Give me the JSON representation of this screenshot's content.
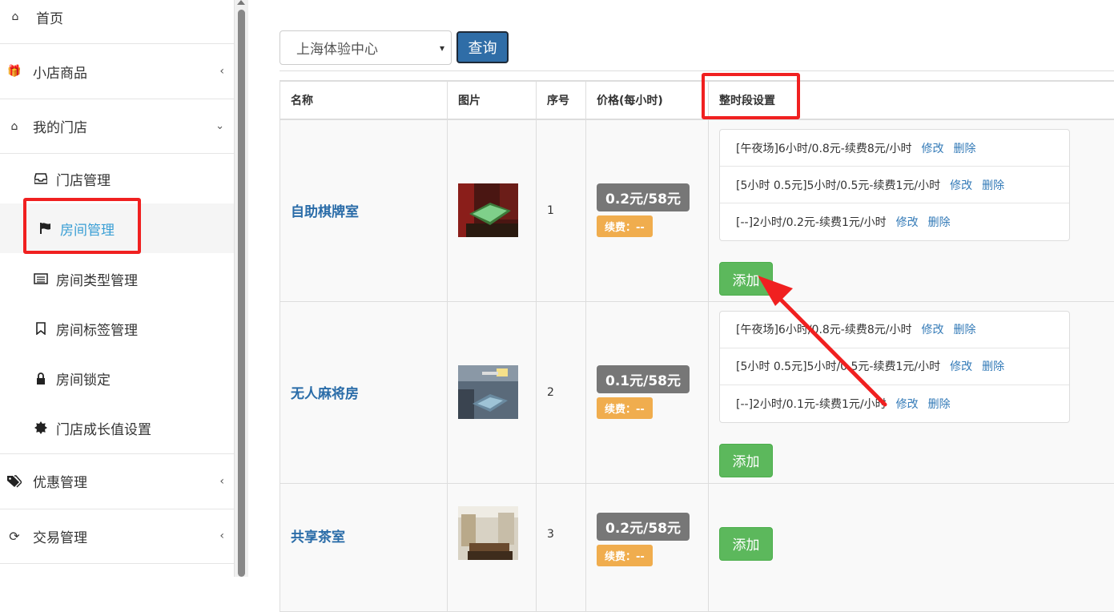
{
  "sidebar": {
    "home": "首页",
    "shop_goods": "小店商品",
    "my_store": "我的门店",
    "sub_items": [
      "门店管理",
      "房间管理",
      "房间类型管理",
      "房间标签管理",
      "房间锁定",
      "门店成长值设置"
    ],
    "discount": "优惠管理",
    "trade": "交易管理"
  },
  "toolbar": {
    "store_select": "上海体验中心",
    "query_label": "查询"
  },
  "table": {
    "headers": [
      "名称",
      "图片",
      "序号",
      "价格(每小时)",
      "整时段设置"
    ],
    "rows": [
      {
        "name": "自助棋牌室",
        "seq": "1",
        "price": "0.2元/58元",
        "renew": "续费：--",
        "slots": [
          "[午夜场]6小时/0.8元-续费8元/小时",
          "[5小时 0.5元]5小时/0.5元-续费1元/小时",
          "[--]2小时/0.2元-续费1元/小时"
        ]
      },
      {
        "name": "无人麻将房",
        "seq": "2",
        "price": "0.1元/58元",
        "renew": "续费：--",
        "slots": [
          "[午夜场]6小时/0.8元-续费8元/小时",
          "[5小时 0.5元]5小时/0.5元-续费1元/小时",
          "[--]2小时/0.1元-续费1元/小时"
        ]
      },
      {
        "name": "共享茶室",
        "seq": "3",
        "price": "0.2元/58元",
        "renew": "续费：--",
        "slots": []
      }
    ],
    "edit_label": "修改",
    "delete_label": "删除",
    "add_label": "添加"
  },
  "colors": {
    "annotation_red": "#f02020",
    "link_blue": "#337ab7",
    "add_green": "#5cb85c",
    "renew_orange": "#f0ad4e",
    "active_text": "#3a9fd5"
  }
}
